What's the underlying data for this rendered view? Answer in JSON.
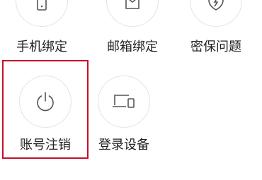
{
  "settings_grid": {
    "items": [
      {
        "label": "手机绑定",
        "icon": "phone-icon"
      },
      {
        "label": "邮箱绑定",
        "icon": "mail-icon"
      },
      {
        "label": "密保问题",
        "icon": "shield-question-icon"
      },
      {
        "label": "账号注销",
        "icon": "power-icon"
      },
      {
        "label": "登录设备",
        "icon": "devices-icon"
      }
    ]
  },
  "highlight": {
    "color": "#c5102a",
    "target": "账号注销"
  }
}
